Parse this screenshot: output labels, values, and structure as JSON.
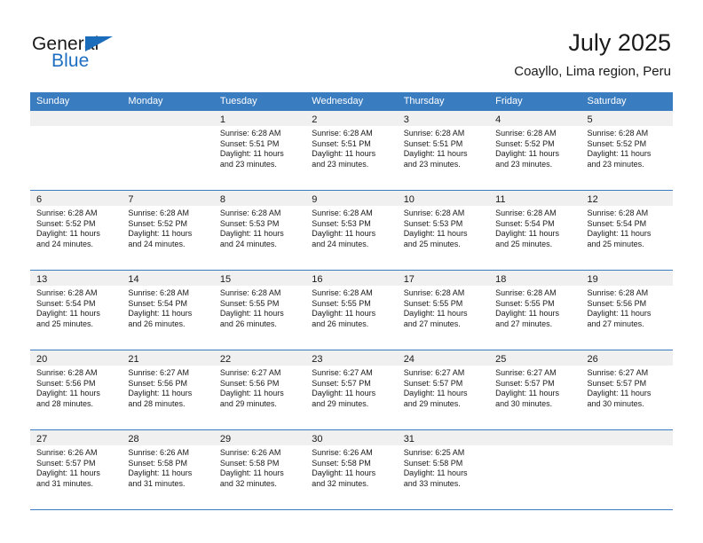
{
  "brand": {
    "word1": "General",
    "word2": "Blue",
    "flag_icon": "triangle-flag-icon",
    "colors": {
      "accent": "#1b6cbb",
      "blue_text": "#1f6fc0"
    }
  },
  "header": {
    "title": "July 2025",
    "subtitle": "Coayllo, Lima region, Peru"
  },
  "theme": {
    "weekday_header_bg": "#3a7cc0",
    "weekday_header_text": "#ffffff",
    "day_strip_bg": "#f0f0f0",
    "row_divider": "#3a7cc0"
  },
  "weekdays": [
    "Sunday",
    "Monday",
    "Tuesday",
    "Wednesday",
    "Thursday",
    "Friday",
    "Saturday"
  ],
  "calendar": {
    "month": "July",
    "year": "2025",
    "location": "Coayllo, Lima region, Peru",
    "weeks": [
      [
        {
          "empty": true
        },
        {
          "empty": true
        },
        {
          "day": "1",
          "sunrise": "Sunrise: 6:28 AM",
          "sunset": "Sunset: 5:51 PM",
          "daylight1": "Daylight: 11 hours",
          "daylight2": "and 23 minutes."
        },
        {
          "day": "2",
          "sunrise": "Sunrise: 6:28 AM",
          "sunset": "Sunset: 5:51 PM",
          "daylight1": "Daylight: 11 hours",
          "daylight2": "and 23 minutes."
        },
        {
          "day": "3",
          "sunrise": "Sunrise: 6:28 AM",
          "sunset": "Sunset: 5:51 PM",
          "daylight1": "Daylight: 11 hours",
          "daylight2": "and 23 minutes."
        },
        {
          "day": "4",
          "sunrise": "Sunrise: 6:28 AM",
          "sunset": "Sunset: 5:52 PM",
          "daylight1": "Daylight: 11 hours",
          "daylight2": "and 23 minutes."
        },
        {
          "day": "5",
          "sunrise": "Sunrise: 6:28 AM",
          "sunset": "Sunset: 5:52 PM",
          "daylight1": "Daylight: 11 hours",
          "daylight2": "and 23 minutes."
        }
      ],
      [
        {
          "day": "6",
          "sunrise": "Sunrise: 6:28 AM",
          "sunset": "Sunset: 5:52 PM",
          "daylight1": "Daylight: 11 hours",
          "daylight2": "and 24 minutes."
        },
        {
          "day": "7",
          "sunrise": "Sunrise: 6:28 AM",
          "sunset": "Sunset: 5:52 PM",
          "daylight1": "Daylight: 11 hours",
          "daylight2": "and 24 minutes."
        },
        {
          "day": "8",
          "sunrise": "Sunrise: 6:28 AM",
          "sunset": "Sunset: 5:53 PM",
          "daylight1": "Daylight: 11 hours",
          "daylight2": "and 24 minutes."
        },
        {
          "day": "9",
          "sunrise": "Sunrise: 6:28 AM",
          "sunset": "Sunset: 5:53 PM",
          "daylight1": "Daylight: 11 hours",
          "daylight2": "and 24 minutes."
        },
        {
          "day": "10",
          "sunrise": "Sunrise: 6:28 AM",
          "sunset": "Sunset: 5:53 PM",
          "daylight1": "Daylight: 11 hours",
          "daylight2": "and 25 minutes."
        },
        {
          "day": "11",
          "sunrise": "Sunrise: 6:28 AM",
          "sunset": "Sunset: 5:54 PM",
          "daylight1": "Daylight: 11 hours",
          "daylight2": "and 25 minutes."
        },
        {
          "day": "12",
          "sunrise": "Sunrise: 6:28 AM",
          "sunset": "Sunset: 5:54 PM",
          "daylight1": "Daylight: 11 hours",
          "daylight2": "and 25 minutes."
        }
      ],
      [
        {
          "day": "13",
          "sunrise": "Sunrise: 6:28 AM",
          "sunset": "Sunset: 5:54 PM",
          "daylight1": "Daylight: 11 hours",
          "daylight2": "and 25 minutes."
        },
        {
          "day": "14",
          "sunrise": "Sunrise: 6:28 AM",
          "sunset": "Sunset: 5:54 PM",
          "daylight1": "Daylight: 11 hours",
          "daylight2": "and 26 minutes."
        },
        {
          "day": "15",
          "sunrise": "Sunrise: 6:28 AM",
          "sunset": "Sunset: 5:55 PM",
          "daylight1": "Daylight: 11 hours",
          "daylight2": "and 26 minutes."
        },
        {
          "day": "16",
          "sunrise": "Sunrise: 6:28 AM",
          "sunset": "Sunset: 5:55 PM",
          "daylight1": "Daylight: 11 hours",
          "daylight2": "and 26 minutes."
        },
        {
          "day": "17",
          "sunrise": "Sunrise: 6:28 AM",
          "sunset": "Sunset: 5:55 PM",
          "daylight1": "Daylight: 11 hours",
          "daylight2": "and 27 minutes."
        },
        {
          "day": "18",
          "sunrise": "Sunrise: 6:28 AM",
          "sunset": "Sunset: 5:55 PM",
          "daylight1": "Daylight: 11 hours",
          "daylight2": "and 27 minutes."
        },
        {
          "day": "19",
          "sunrise": "Sunrise: 6:28 AM",
          "sunset": "Sunset: 5:56 PM",
          "daylight1": "Daylight: 11 hours",
          "daylight2": "and 27 minutes."
        }
      ],
      [
        {
          "day": "20",
          "sunrise": "Sunrise: 6:28 AM",
          "sunset": "Sunset: 5:56 PM",
          "daylight1": "Daylight: 11 hours",
          "daylight2": "and 28 minutes."
        },
        {
          "day": "21",
          "sunrise": "Sunrise: 6:27 AM",
          "sunset": "Sunset: 5:56 PM",
          "daylight1": "Daylight: 11 hours",
          "daylight2": "and 28 minutes."
        },
        {
          "day": "22",
          "sunrise": "Sunrise: 6:27 AM",
          "sunset": "Sunset: 5:56 PM",
          "daylight1": "Daylight: 11 hours",
          "daylight2": "and 29 minutes."
        },
        {
          "day": "23",
          "sunrise": "Sunrise: 6:27 AM",
          "sunset": "Sunset: 5:57 PM",
          "daylight1": "Daylight: 11 hours",
          "daylight2": "and 29 minutes."
        },
        {
          "day": "24",
          "sunrise": "Sunrise: 6:27 AM",
          "sunset": "Sunset: 5:57 PM",
          "daylight1": "Daylight: 11 hours",
          "daylight2": "and 29 minutes."
        },
        {
          "day": "25",
          "sunrise": "Sunrise: 6:27 AM",
          "sunset": "Sunset: 5:57 PM",
          "daylight1": "Daylight: 11 hours",
          "daylight2": "and 30 minutes."
        },
        {
          "day": "26",
          "sunrise": "Sunrise: 6:27 AM",
          "sunset": "Sunset: 5:57 PM",
          "daylight1": "Daylight: 11 hours",
          "daylight2": "and 30 minutes."
        }
      ],
      [
        {
          "day": "27",
          "sunrise": "Sunrise: 6:26 AM",
          "sunset": "Sunset: 5:57 PM",
          "daylight1": "Daylight: 11 hours",
          "daylight2": "and 31 minutes."
        },
        {
          "day": "28",
          "sunrise": "Sunrise: 6:26 AM",
          "sunset": "Sunset: 5:58 PM",
          "daylight1": "Daylight: 11 hours",
          "daylight2": "and 31 minutes."
        },
        {
          "day": "29",
          "sunrise": "Sunrise: 6:26 AM",
          "sunset": "Sunset: 5:58 PM",
          "daylight1": "Daylight: 11 hours",
          "daylight2": "and 32 minutes."
        },
        {
          "day": "30",
          "sunrise": "Sunrise: 6:26 AM",
          "sunset": "Sunset: 5:58 PM",
          "daylight1": "Daylight: 11 hours",
          "daylight2": "and 32 minutes."
        },
        {
          "day": "31",
          "sunrise": "Sunrise: 6:25 AM",
          "sunset": "Sunset: 5:58 PM",
          "daylight1": "Daylight: 11 hours",
          "daylight2": "and 33 minutes."
        },
        {
          "empty": true
        },
        {
          "empty": true
        }
      ]
    ]
  }
}
